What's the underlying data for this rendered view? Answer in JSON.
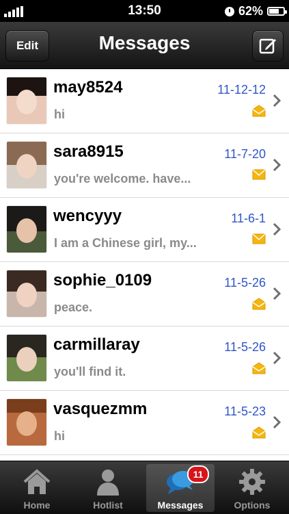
{
  "status_bar": {
    "time": "13:50",
    "battery": "62%",
    "icons": [
      "signal-icon",
      "clock-icon",
      "battery-icon"
    ]
  },
  "nav": {
    "title": "Messages",
    "edit_label": "Edit",
    "compose_icon": "compose-icon"
  },
  "messages": [
    {
      "name": "may8524",
      "preview": "hi",
      "date": "11-12-12",
      "status": "opened-envelope-icon"
    },
    {
      "name": "sara8915",
      "preview": "you're welcome. have...",
      "date": "11-7-20",
      "status": "envelope-icon"
    },
    {
      "name": "wencyyy",
      "preview": "I am a Chinese girl, my...",
      "date": "11-6-1",
      "status": "envelope-icon"
    },
    {
      "name": "sophie_0109",
      "preview": "peace.",
      "date": "11-5-26",
      "status": "opened-envelope-icon"
    },
    {
      "name": "carmillaray",
      "preview": "you'll find it.",
      "date": "11-5-26",
      "status": "opened-envelope-icon"
    },
    {
      "name": "vasquezmm",
      "preview": "hi",
      "date": "11-5-23",
      "status": "opened-envelope-icon"
    }
  ],
  "tabs": [
    {
      "label": "Home",
      "icon": "home-icon"
    },
    {
      "label": "Hotlist",
      "icon": "person-icon"
    },
    {
      "label": "Messages",
      "icon": "chat-bubbles-icon",
      "badge": "11",
      "active": true
    },
    {
      "label": "Options",
      "icon": "gear-icon"
    }
  ],
  "colors": {
    "date": "#2f55c8",
    "envelope": "#f5b50f",
    "badge": "#d7141a",
    "chat_icon": "#3a9be0"
  }
}
